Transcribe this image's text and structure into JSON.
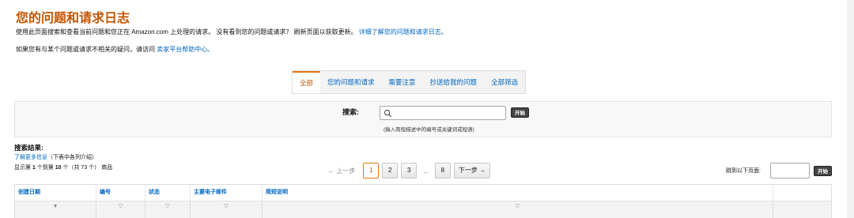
{
  "header": {
    "title": "您的问题和请求日志",
    "intro_text": "使用此页面搜索和查看当前问题和您正在 Amazon.com 上处理的请求。 没有看到您的问题或请求？ 刷新页面以获取更新。 ",
    "intro_link": "详细了解您的问题和请求日志。",
    "unrelated_text": "如果您有与某个问题或请求不相关的疑问，请访问 ",
    "unrelated_link": "卖家平台帮助中心。"
  },
  "tabs": [
    {
      "label": "全部",
      "active": true
    },
    {
      "label": "您的问题和请求",
      "active": false
    },
    {
      "label": "需要注意",
      "active": false
    },
    {
      "label": "抄送给我的问题",
      "active": false
    },
    {
      "label": "全部筛选",
      "active": false
    }
  ],
  "search": {
    "label": "搜索:",
    "value": "",
    "button_label": "开始",
    "hint": "(输入简短描述中的编号或关键词或短语)"
  },
  "results": {
    "title": "搜索结果:",
    "more_link": "了解更多信息",
    "more_suffix": "（下表中各列介绍）",
    "count_prefix": "显示第 ",
    "count_from": "1",
    "count_mid": " 个到第 ",
    "count_to": "10",
    "count_suffix": " 个（共 73 个） 商品"
  },
  "pagination": {
    "prev_label": "← 上一步",
    "pages": [
      "1",
      "2",
      "3"
    ],
    "ellipsis": "...",
    "last_page": "8",
    "next_label": "下一步 →",
    "current_page": 1
  },
  "jump": {
    "label": "跳到以下页面:",
    "value": "",
    "button_label": "开始"
  },
  "table": {
    "columns": [
      "创建日期",
      "编号",
      "状态",
      "主要电子邮件",
      "简短说明"
    ],
    "filter_glyph": "▽",
    "filter_glyph_active": "▼"
  },
  "colors": {
    "title": "#c45500",
    "link": "#0066c0",
    "accent": "#e47911"
  }
}
